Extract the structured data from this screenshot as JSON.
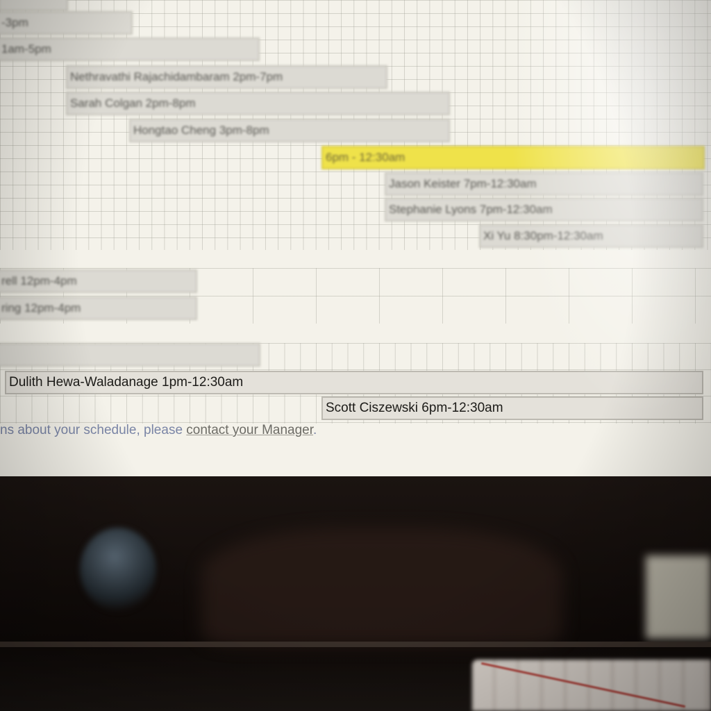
{
  "schedule": {
    "rows_top": [
      {
        "label": "-3pm"
      },
      {
        "label": "1am-5pm"
      },
      {
        "label": "Nethravathi Rajachidambaram 2pm-7pm"
      },
      {
        "label": "Sarah Colgan 2pm-8pm"
      },
      {
        "label": "Hongtao Cheng 3pm-8pm"
      },
      {
        "label": "6pm - 12:30am",
        "highlighted": true
      },
      {
        "label": "Jason Keister 7pm-12:30am"
      },
      {
        "label": "Stephanie Lyons 7pm-12:30am"
      },
      {
        "label": "Xi Yu 8:30pm-12:30am"
      }
    ],
    "rows_middle": [
      {
        "label": "rell 12pm-4pm"
      },
      {
        "label": "ring 12pm-4pm"
      }
    ],
    "rows_bottom": [
      {
        "label": ""
      },
      {
        "label": "Dulith Hewa-Waladanage 1pm-12:30am"
      },
      {
        "label": "Scott Ciszewski 6pm-12:30am"
      }
    ]
  },
  "footer": {
    "text_before": "ns about your schedule, please ",
    "link": "contact your Manager",
    "text_after": "."
  },
  "colors": {
    "highlight": "#efe24a",
    "shift_bar": "#dcdad3",
    "footer_text": "#7a85a6"
  }
}
